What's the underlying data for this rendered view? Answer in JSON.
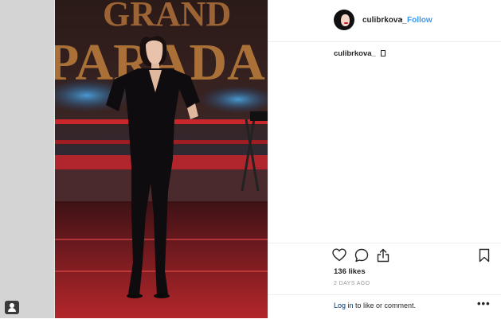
{
  "post": {
    "author": "culibrkova_",
    "separator": "•",
    "follow_label": "Follow",
    "caption_user": "culibrkova_",
    "caption_text": "",
    "likes": "136 likes",
    "timestamp": "2 DAYS AGO",
    "login_link": "Log in",
    "login_rest": " to like or comment.",
    "more_label": "•••"
  },
  "photo": {
    "backdrop_letters": "GRAND PARADA"
  },
  "icons": {
    "like": "heart-icon",
    "comment": "comment-icon",
    "share": "share-icon",
    "save": "bookmark-icon",
    "user_badge": "person-icon"
  },
  "colors": {
    "link_blue": "#3897f0",
    "text": "#262626",
    "muted": "#999999",
    "stage_red": "#c8262a"
  }
}
